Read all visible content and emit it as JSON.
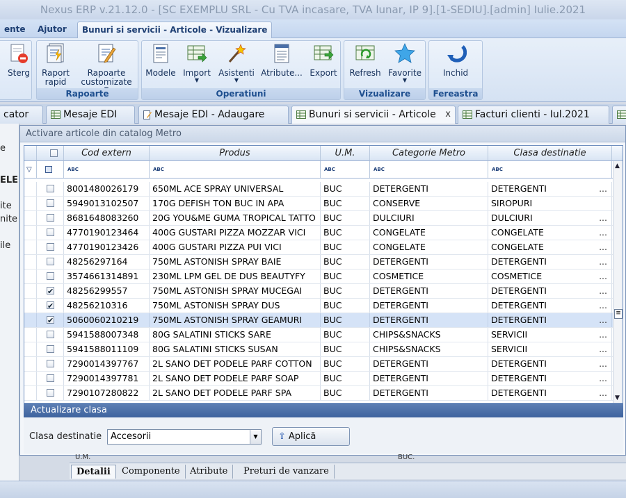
{
  "window": {
    "title": "Nexus ERP v.21.12.0 - [SC EXEMPLU SRL - Cu TVA incasare, TVA lunar, IP 9].[1-SEDIU].[admin] Iulie.2021"
  },
  "menu": {
    "tabs": [
      {
        "label": "ente"
      },
      {
        "label": "Ajutor"
      },
      {
        "label": "Bunuri si servicii - Articole - Vizualizare"
      }
    ]
  },
  "ribbon": {
    "groups": [
      {
        "label": "",
        "buttons": [
          {
            "label": "Sterg",
            "icon": "delete-icon"
          }
        ]
      },
      {
        "label": "Rapoarte",
        "buttons": [
          {
            "label": "Raport rapid",
            "icon": "report-icon"
          },
          {
            "label": "Rapoarte customizate",
            "icon": "custom-report-icon"
          }
        ]
      },
      {
        "label": "Operatiuni",
        "buttons": [
          {
            "label": "Modele",
            "icon": "models-icon"
          },
          {
            "label": "Import",
            "icon": "import-icon"
          },
          {
            "label": "Asistenti",
            "icon": "wizard-icon"
          },
          {
            "label": "Atribute...",
            "icon": "attributes-icon"
          },
          {
            "label": "Export",
            "icon": "export-icon"
          }
        ]
      },
      {
        "label": "Vizualizare",
        "buttons": [
          {
            "label": "Refresh",
            "icon": "refresh-icon"
          },
          {
            "label": "Favorite",
            "icon": "star-icon"
          }
        ]
      },
      {
        "label": "Fereastra",
        "buttons": [
          {
            "label": "Inchid",
            "icon": "close-window-icon"
          }
        ]
      }
    ]
  },
  "doc_tabs": [
    {
      "label": "cator"
    },
    {
      "label": "Mesaje EDI"
    },
    {
      "label": "Mesaje EDI - Adaugare"
    },
    {
      "label": "Bunuri si servicii - Articole",
      "close": "x"
    },
    {
      "label": "Facturi clienti - Iul.2021"
    }
  ],
  "left_panel": {
    "texts": [
      "e",
      "ELE",
      "ite",
      "nite",
      "ile"
    ]
  },
  "dialog": {
    "title": "Activare articole din catalog Metro",
    "grid": {
      "columns": [
        "Cod extern",
        "Produs",
        "U.M.",
        "Categorie Metro",
        "Clasa destinatie"
      ],
      "filter_glyph": "ABC",
      "rows": [
        {
          "checked": false,
          "cod": "8001480026179",
          "produs": "650ML ACE SPRAY UNIVERSAL",
          "um": "BUC",
          "categorie": "DETERGENTI",
          "clasa": "DETERGENTI",
          "more": "..."
        },
        {
          "checked": false,
          "cod": "5949013102507",
          "produs": "170G DEFISH TON BUC IN APA",
          "um": "BUC",
          "categorie": "CONSERVE",
          "clasa": "SIROPURI",
          "more": ""
        },
        {
          "checked": false,
          "cod": "8681648083260",
          "produs": "20G YOU&ME GUMA TROPICAL TATTO",
          "um": "BUC",
          "categorie": "DULCIURI",
          "clasa": "DULCIURI",
          "more": "..."
        },
        {
          "checked": false,
          "cod": "4770190123464",
          "produs": "400G GUSTARI PIZZA MOZZAR VICI",
          "um": "BUC",
          "categorie": "CONGELATE",
          "clasa": "CONGELATE",
          "more": "..."
        },
        {
          "checked": false,
          "cod": "4770190123426",
          "produs": "400G GUSTARI PIZZA PUI VICI",
          "um": "BUC",
          "categorie": "CONGELATE",
          "clasa": "CONGELATE",
          "more": "..."
        },
        {
          "checked": false,
          "cod": "48256297164",
          "produs": "750ML ASTONISH SPRAY BAIE",
          "um": "BUC",
          "categorie": "DETERGENTI",
          "clasa": "DETERGENTI",
          "more": "..."
        },
        {
          "checked": false,
          "cod": "3574661314891",
          "produs": "230ML LPM GEL DE DUS BEAUTYFY",
          "um": "BUC",
          "categorie": "COSMETICE",
          "clasa": "COSMETICE",
          "more": "..."
        },
        {
          "checked": true,
          "cod": "48256299557",
          "produs": "750ML ASTONISH SPRAY MUCEGAI",
          "um": "BUC",
          "categorie": "DETERGENTI",
          "clasa": "DETERGENTI",
          "more": "..."
        },
        {
          "checked": true,
          "cod": "48256210316",
          "produs": "750ML ASTONISH SPRAY DUS",
          "um": "BUC",
          "categorie": "DETERGENTI",
          "clasa": "DETERGENTI",
          "more": "..."
        },
        {
          "checked": true,
          "cod": "5060060210219",
          "produs": "750ML ASTONISH SPRAY GEAMURI",
          "um": "BUC",
          "categorie": "DETERGENTI",
          "clasa": "DETERGENTI",
          "more": "...",
          "selected": true
        },
        {
          "checked": false,
          "cod": "5941588007348",
          "produs": "80G SALATINI STICKS SARE",
          "um": "BUC",
          "categorie": "CHIPS&SNACKS",
          "clasa": "SERVICII",
          "more": "..."
        },
        {
          "checked": false,
          "cod": "5941588011109",
          "produs": "80G SALATINI STICKS SUSAN",
          "um": "BUC",
          "categorie": "CHIPS&SNACKS",
          "clasa": "SERVICII",
          "more": "..."
        },
        {
          "checked": false,
          "cod": "7290014397767",
          "produs": "2L SANO DET PODELE PARF COTTON",
          "um": "BUC",
          "categorie": "DETERGENTI",
          "clasa": "DETERGENTI",
          "more": "..."
        },
        {
          "checked": false,
          "cod": "7290014397781",
          "produs": "2L SANO DET PODELE PARF SOAP",
          "um": "BUC",
          "categorie": "DETERGENTI",
          "clasa": "DETERGENTI",
          "more": "..."
        },
        {
          "checked": false,
          "cod": "7290107280822",
          "produs": "2L SANO DET PODELE PARF SPA",
          "um": "BUC",
          "categorie": "DETERGENTI",
          "clasa": "DETERGENTI",
          "more": "..."
        }
      ]
    },
    "update": {
      "header": "Actualizare clasa",
      "label": "Clasa destinatie",
      "value": "Accesorii",
      "apply_label": "Aplică"
    }
  },
  "behind": {
    "um_label": "U.M.",
    "buc_label": "BUC."
  },
  "bottom_tabs": [
    {
      "label": "Detalii"
    },
    {
      "label": "Componente"
    },
    {
      "label": "Atribute"
    },
    {
      "label": "Preturi de vanzare"
    }
  ]
}
